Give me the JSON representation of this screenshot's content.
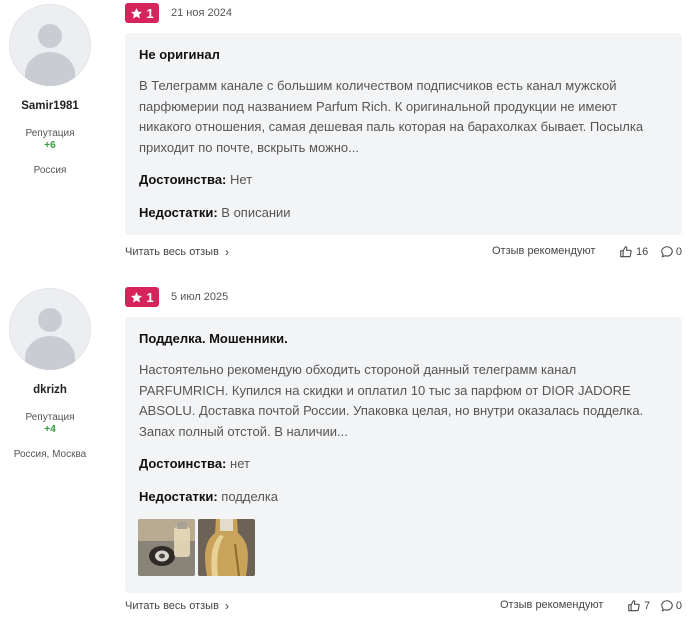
{
  "reviews": [
    {
      "user": {
        "name": "Samir1981",
        "reputation_label": "Репутация",
        "reputation": "+6",
        "location": "Россия"
      },
      "rating": "1",
      "date": "21 ноя 2024",
      "title": "Не оригинал",
      "text": "В Телеграмм канале с большим количеством подписчиков есть канал мужской парфюмерии под названием Parfum Rich. К оригинальной продукции не имеют никакого отношения, самая дешевая паль которая на барахолках бывает. Посылка приходит по почте, вскрыть можно...",
      "pros_label": "Достоинства:",
      "pros": "Нет",
      "cons_label": "Недостатки:",
      "cons": "В описании",
      "read_more": "Читать весь отзыв",
      "recommend_label": "Отзыв рекомендуют",
      "likes": "16",
      "comments": "0"
    },
    {
      "user": {
        "name": "dkrizh",
        "reputation_label": "Репутация",
        "reputation": "+4",
        "location": "Россия, Москва"
      },
      "rating": "1",
      "date": "5 июл 2025",
      "title": "Подделка. Мошенники.",
      "text": "Настоятельно рекомендую обходить стороной данный телеграмм канал PARFUMRICH. Купился на скидки и оплатил 10 тыс за парфюм от DIOR JADORE ABSOLU. Доставка почтой России. Упаковка целая, но внутри оказалась подделка. Запах полный отстой. В наличии...",
      "pros_label": "Достоинства:",
      "pros": "нет",
      "cons_label": "Недостатки:",
      "cons": "подделка",
      "read_more": "Читать весь отзыв",
      "recommend_label": "Отзыв рекомендуют",
      "likes": "7",
      "comments": "0"
    }
  ],
  "colors": {
    "badge": "#d6245a",
    "reputation": "#2e9e3b",
    "card": "#f3f4f6"
  }
}
